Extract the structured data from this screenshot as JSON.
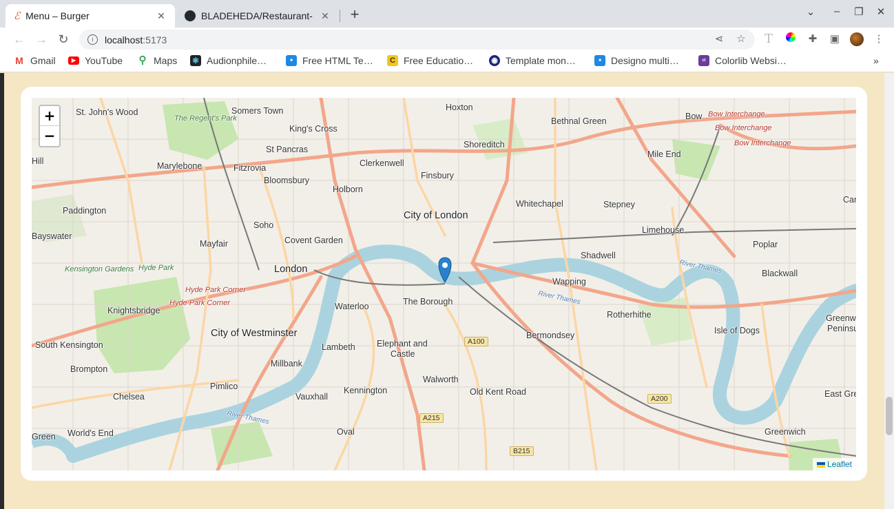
{
  "browser": {
    "tabs": [
      {
        "title": "Menu – Burger",
        "active": true
      },
      {
        "title": "BLADEHEDA/Restaurant-",
        "active": false
      }
    ],
    "new_tab": "+",
    "close_glyph": "✕",
    "url_host": "localhost",
    "url_port": ":5173",
    "bookmarks": [
      {
        "label": "Gmail",
        "icon": "gmail-icon",
        "color": "#ea4335"
      },
      {
        "label": "YouTube",
        "icon": "youtube-icon",
        "color": "#ff0000"
      },
      {
        "label": "Maps",
        "icon": "maps-icon",
        "color": "#34a853"
      },
      {
        "label": "Audionphile…",
        "icon": "react-icon",
        "color": "#20232a"
      },
      {
        "label": "Free HTML Te…",
        "icon": "site-icon",
        "color": "#1e88e5"
      },
      {
        "label": "Free Educatio…",
        "icon": "c-icon",
        "color": "#f5c518"
      },
      {
        "label": "Template mon…",
        "icon": "template-icon",
        "color": "#1a237e"
      },
      {
        "label": "Designo multi…",
        "icon": "site-icon",
        "color": "#1e88e5"
      },
      {
        "label": "Colorlib Websi…",
        "icon": "colorlib-icon",
        "color": "#6a3d9a"
      }
    ],
    "bookmarks_more": "»"
  },
  "map": {
    "zoom_in": "+",
    "zoom_out": "−",
    "attribution": "Leaflet",
    "places": [
      {
        "text": "St. John's Wood",
        "cls": ""
      },
      {
        "text": "Somers Town",
        "cls": ""
      },
      {
        "text": "Hoxton",
        "cls": ""
      },
      {
        "text": "Bethnal Green",
        "cls": ""
      },
      {
        "text": "Bow",
        "cls": ""
      },
      {
        "text": "King's Cross",
        "cls": ""
      },
      {
        "text": "Shoreditch",
        "cls": ""
      },
      {
        "text": "St Pancras",
        "cls": ""
      },
      {
        "text": "Mile End",
        "cls": ""
      },
      {
        "text": "Marylebone",
        "cls": ""
      },
      {
        "text": "Fitzrovia",
        "cls": ""
      },
      {
        "text": "Clerkenwell",
        "cls": ""
      },
      {
        "text": "Finsbury",
        "cls": ""
      },
      {
        "text": "Bloomsbury",
        "cls": ""
      },
      {
        "text": "Holborn",
        "cls": ""
      },
      {
        "text": "Paddington",
        "cls": ""
      },
      {
        "text": "Whitechapel",
        "cls": ""
      },
      {
        "text": "Stepney",
        "cls": ""
      },
      {
        "text": "Soho",
        "cls": ""
      },
      {
        "text": "City of London",
        "cls": "big"
      },
      {
        "text": "Limehouse",
        "cls": ""
      },
      {
        "text": "Bayswater",
        "cls": ""
      },
      {
        "text": "Mayfair",
        "cls": ""
      },
      {
        "text": "Covent Garden",
        "cls": ""
      },
      {
        "text": "Poplar",
        "cls": ""
      },
      {
        "text": "Shadwell",
        "cls": ""
      },
      {
        "text": "London",
        "cls": "big"
      },
      {
        "text": "Blackwall",
        "cls": ""
      },
      {
        "text": "Wapping",
        "cls": ""
      },
      {
        "text": "Waterloo",
        "cls": ""
      },
      {
        "text": "The Borough",
        "cls": ""
      },
      {
        "text": "Knightsbridge",
        "cls": ""
      },
      {
        "text": "Rotherhithe",
        "cls": ""
      },
      {
        "text": "Greenwich",
        "cls": ""
      },
      {
        "text": "Peninsula",
        "cls": ""
      },
      {
        "text": "City of Westminster",
        "cls": "big"
      },
      {
        "text": "Bermondsey",
        "cls": ""
      },
      {
        "text": "Isle of Dogs",
        "cls": ""
      },
      {
        "text": "South Kensington",
        "cls": ""
      },
      {
        "text": "Lambeth",
        "cls": ""
      },
      {
        "text": "Elephant and",
        "cls": ""
      },
      {
        "text": "Castle",
        "cls": ""
      },
      {
        "text": "Millbank",
        "cls": ""
      },
      {
        "text": "Brompton",
        "cls": ""
      },
      {
        "text": "Walworth",
        "cls": ""
      },
      {
        "text": "Pimlico",
        "cls": ""
      },
      {
        "text": "Kennington",
        "cls": ""
      },
      {
        "text": "Old Kent Road",
        "cls": ""
      },
      {
        "text": "Chelsea",
        "cls": ""
      },
      {
        "text": "Vauxhall",
        "cls": ""
      },
      {
        "text": "East Green",
        "cls": ""
      },
      {
        "text": "World's End",
        "cls": ""
      },
      {
        "text": "Oval",
        "cls": ""
      },
      {
        "text": "Greenwich",
        "cls": ""
      },
      {
        "text": "Green",
        "cls": ""
      },
      {
        "text": "Hill",
        "cls": ""
      },
      {
        "text": "Canni",
        "cls": ""
      },
      {
        "text": "The Regent's Park",
        "cls": "park"
      },
      {
        "text": "Kensington Gardens",
        "cls": "park"
      },
      {
        "text": "Hyde Park",
        "cls": "park"
      },
      {
        "text": "Hyde Park Corner",
        "cls": "red"
      },
      {
        "text": "Hyde Park Corner",
        "cls": "red"
      },
      {
        "text": "Bow Interchange",
        "cls": "red"
      },
      {
        "text": "Bow Interchange",
        "cls": "red"
      },
      {
        "text": "Bow Interchange",
        "cls": "red"
      },
      {
        "text": "River Thames",
        "cls": "water"
      },
      {
        "text": "River Thames",
        "cls": "water"
      },
      {
        "text": "River Thames",
        "cls": "water"
      }
    ],
    "shields": [
      "A100",
      "A215",
      "A200",
      "B215"
    ]
  }
}
